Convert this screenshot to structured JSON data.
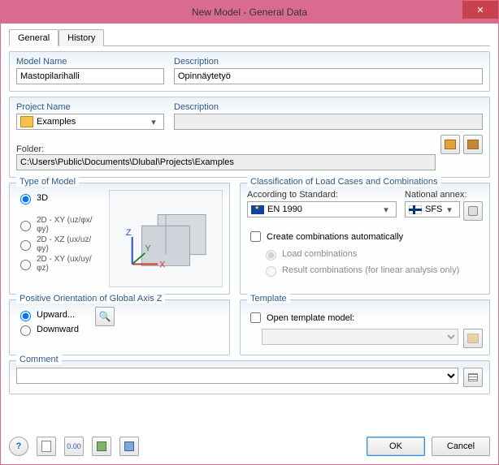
{
  "window": {
    "title": "New Model - General Data",
    "close": "✕"
  },
  "tabs": {
    "general": "General",
    "history": "History"
  },
  "model": {
    "name_label": "Model Name",
    "name_value": "Mastopilarihalli",
    "desc_label": "Description",
    "desc_value": "Opinnäytetyö"
  },
  "project": {
    "name_label": "Project Name",
    "desc_label": "Description",
    "combo_value": "Examples",
    "desc_value": "",
    "folder_label": "Folder:",
    "folder_value": "C:\\Users\\Public\\Documents\\Dlubal\\Projects\\Examples"
  },
  "type_of_model": {
    "legend": "Type of Model",
    "r0": "3D",
    "r1": "2D - XY (uz/φx/φy)",
    "r2": "2D - XZ (ux/uz/φy)",
    "r3": "2D - XY (ux/uy/φz)"
  },
  "classification": {
    "legend": "Classification of Load Cases and Combinations",
    "std_label": "According to Standard:",
    "annex_label": "National annex:",
    "std_value": "EN 1990",
    "annex_value": "SFS",
    "chk_auto": "Create combinations automatically",
    "opt_load": "Load combinations",
    "opt_result": "Result combinations (for linear analysis only)"
  },
  "orientation": {
    "legend": "Positive Orientation of Global Axis Z",
    "up": "Upward...",
    "down": "Downward"
  },
  "template": {
    "legend": "Template",
    "chk": "Open template model:"
  },
  "comment": {
    "legend": "Comment"
  },
  "buttons": {
    "ok": "OK",
    "cancel": "Cancel"
  }
}
